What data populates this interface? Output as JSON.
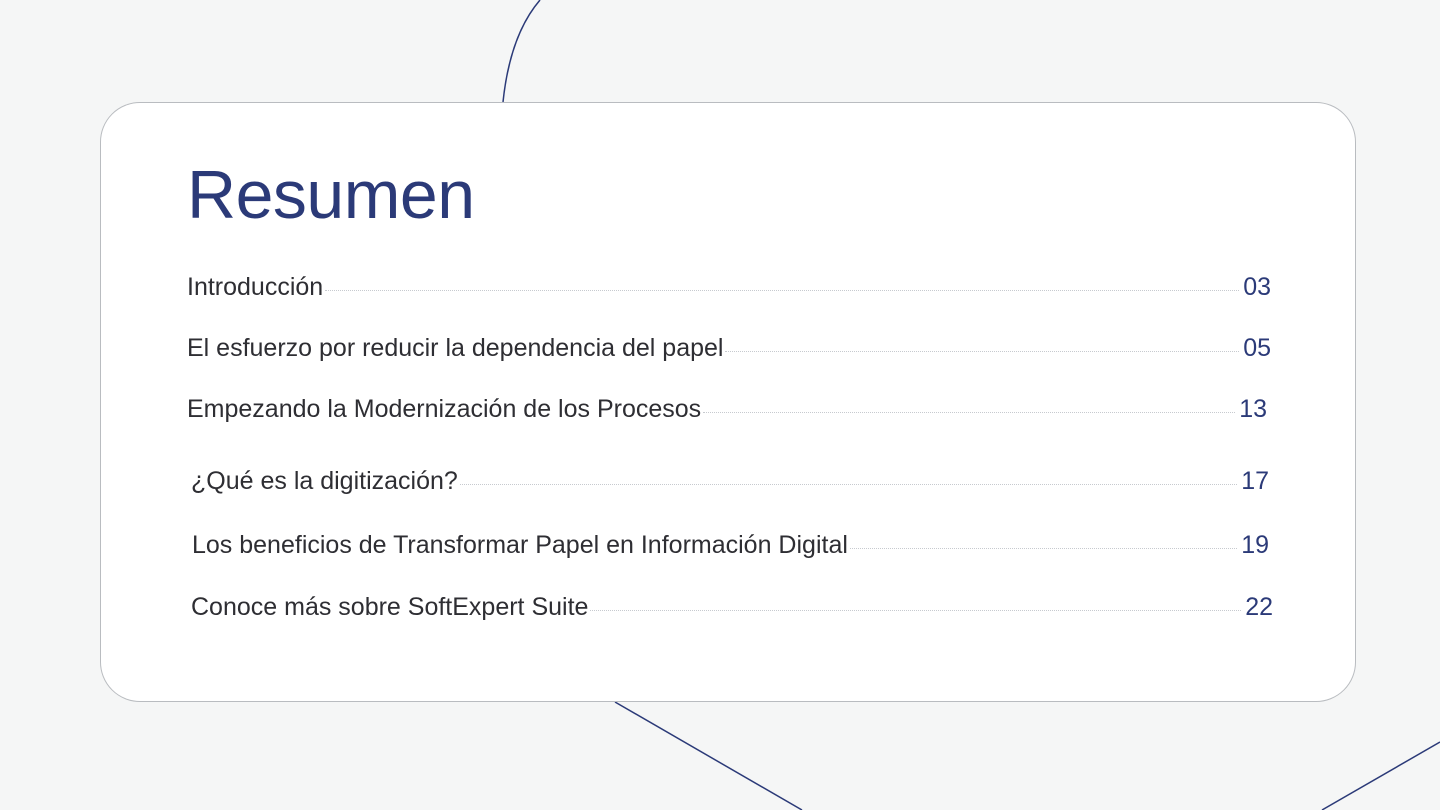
{
  "title": "Resumen",
  "toc": [
    {
      "label": "Introducción",
      "page": "03"
    },
    {
      "label": "El esfuerzo por reducir la dependencia del papel",
      "page": "05"
    },
    {
      "label": "Empezando la Modernización de los Procesos",
      "page": "13"
    },
    {
      "label": "¿Qué es la digitización?",
      "page": "17"
    },
    {
      "label": "Los beneficios de Transformar Papel en Información Digital",
      "page": "19"
    },
    {
      "label": "Conoce más sobre SoftExpert Suite",
      "page": "22"
    }
  ],
  "colors": {
    "accent": "#2b3a78",
    "background": "#f5f6f6",
    "card": "#ffffff",
    "text": "#2e2e33",
    "leader": "#c7cacf"
  }
}
